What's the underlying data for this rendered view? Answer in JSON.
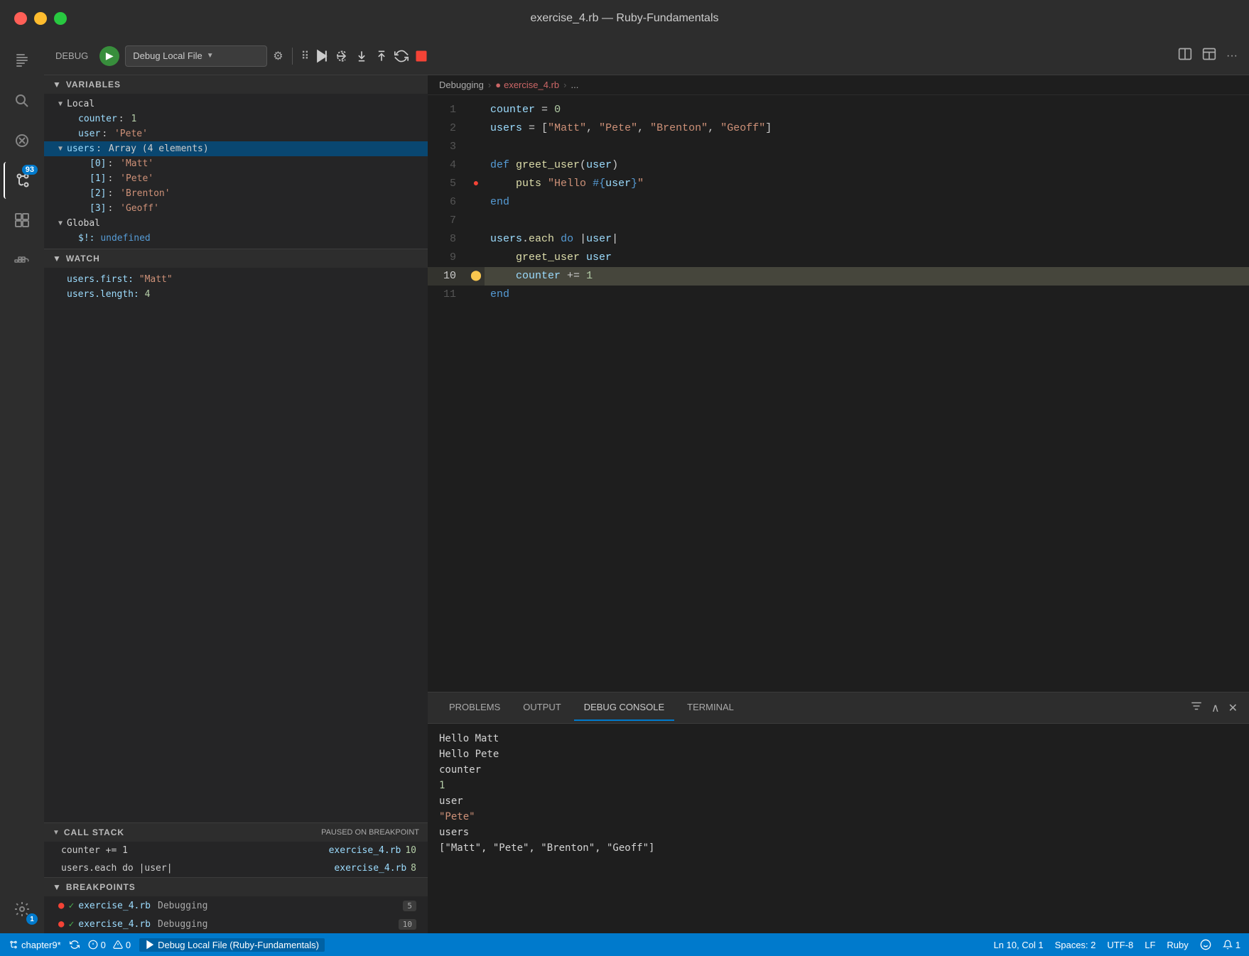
{
  "titlebar": {
    "title": "exercise_4.rb — Ruby-Fundamentals"
  },
  "toolbar": {
    "debug_label": "DEBUG",
    "config_name": "Debug Local File",
    "actions": [
      "continue",
      "step-over",
      "step-into",
      "step-out",
      "restart",
      "stop"
    ]
  },
  "sidebar": {
    "variables_header": "VARIABLES",
    "local_label": "Local",
    "global_label": "Global",
    "variables": {
      "counter": "1",
      "user": "'Pete'",
      "users": "Array (4 elements)",
      "users_items": [
        "'Matt'",
        "'Pete'",
        "'Brenton'",
        "'Geoff'"
      ],
      "global_si": "undefined"
    },
    "watch_header": "WATCH",
    "watch_items": [
      {
        "expr": "users.first:",
        "val": "\"Matt\""
      },
      {
        "expr": "users.length:",
        "val": "4"
      }
    ],
    "callstack_header": "CALL STACK",
    "callstack_badge": "PAUSED ON BREAKPOINT",
    "callstack_items": [
      {
        "fn": "counter += 1",
        "file": "exercise_4.rb",
        "line": "10"
      },
      {
        "fn": "users.each do |user|",
        "file": "exercise_4.rb",
        "line": "8"
      }
    ],
    "breakpoints_header": "BREAKPOINTS",
    "breakpoints": [
      {
        "file": "exercise_4.rb",
        "folder": "Debugging",
        "line": "5"
      },
      {
        "file": "exercise_4.rb",
        "folder": "Debugging",
        "line": "10"
      }
    ]
  },
  "editor": {
    "breadcrumb": [
      "Debugging",
      "exercise_4.rb",
      "..."
    ],
    "lines": [
      {
        "num": 1,
        "code": "counter = 0",
        "type": "plain"
      },
      {
        "num": 2,
        "code": "users = [\"Matt\", \"Pete\", \"Brenton\", \"Geoff\"]",
        "type": "array"
      },
      {
        "num": 3,
        "code": "",
        "type": "blank"
      },
      {
        "num": 4,
        "code": "def greet_user(user)",
        "type": "def"
      },
      {
        "num": 5,
        "code": "  puts \"Hello #{user}\"",
        "type": "puts",
        "breakpoint": true
      },
      {
        "num": 6,
        "code": "end",
        "type": "end"
      },
      {
        "num": 7,
        "code": "",
        "type": "blank"
      },
      {
        "num": 8,
        "code": "users.each do |user|",
        "type": "each"
      },
      {
        "num": 9,
        "code": "  greet_user user",
        "type": "call"
      },
      {
        "num": 10,
        "code": "  counter += 1",
        "type": "counter",
        "breakpoint": true,
        "current": true
      },
      {
        "num": 11,
        "code": "end",
        "type": "end"
      }
    ]
  },
  "panel": {
    "tabs": [
      "PROBLEMS",
      "OUTPUT",
      "DEBUG CONSOLE",
      "TERMINAL"
    ],
    "active_tab": "DEBUG CONSOLE",
    "console_output": [
      "Hello Matt",
      "Hello Pete",
      "counter",
      "1",
      "user",
      "\"Pete\"",
      "users",
      "[\"Matt\", \"Pete\", \"Brenton\", \"Geoff\"]"
    ]
  },
  "statusbar": {
    "branch": "chapter9*",
    "errors": "0",
    "warnings": "0",
    "debug_label": "Debug Local File (Ruby-Fundamentals)",
    "position": "Ln 10, Col 1",
    "spaces": "Spaces: 2",
    "encoding": "UTF-8",
    "line_ending": "LF",
    "language": "Ruby",
    "notifications": "1"
  },
  "activity_bar": {
    "items": [
      "explorer",
      "search",
      "no-signal",
      "source-control",
      "extensions",
      "docker"
    ],
    "badge_count": "93",
    "gear_badge": "1"
  }
}
